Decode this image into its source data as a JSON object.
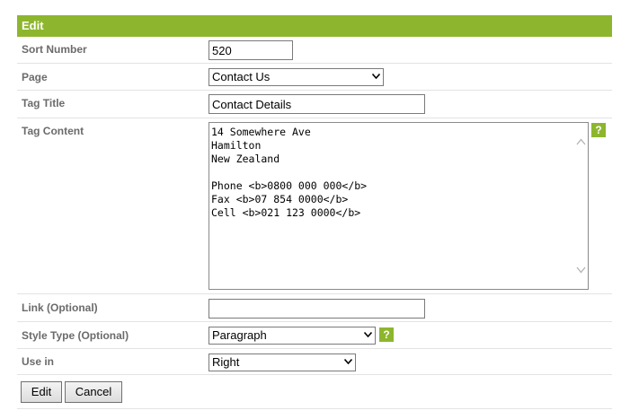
{
  "form": {
    "header": "Edit",
    "sort_number": {
      "label": "Sort Number",
      "value": "520"
    },
    "page": {
      "label": "Page",
      "selected": "Contact Us"
    },
    "tag_title": {
      "label": "Tag Title",
      "value": "Contact Details"
    },
    "tag_content": {
      "label": "Tag Content",
      "value": "14 Somewhere Ave\nHamilton\nNew Zealand\n\nPhone <b>0800 000 000</b>\nFax <b>07 854 0000</b>\nCell <b>021 123 0000</b>",
      "help": "?"
    },
    "link": {
      "label": "Link (Optional)",
      "value": ""
    },
    "style_type": {
      "label": "Style Type (Optional)",
      "selected": "Paragraph",
      "help": "?"
    },
    "use_in": {
      "label": "Use in",
      "selected": "Right"
    },
    "buttons": {
      "edit": "Edit",
      "cancel": "Cancel"
    }
  },
  "colors": {
    "accent": "#8db62e",
    "label": "#6b6b6b",
    "divider": "#e3e3e3"
  }
}
